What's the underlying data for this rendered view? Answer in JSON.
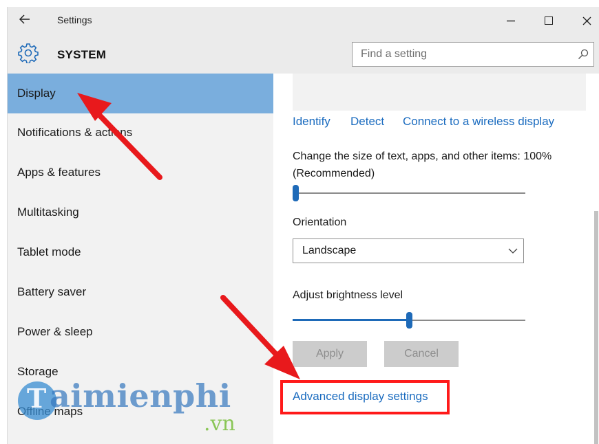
{
  "titlebar": {
    "back_icon": "back-arrow-icon",
    "title": "Settings",
    "minimize_icon": "minimize-icon",
    "maximize_icon": "maximize-icon",
    "close_icon": "close-icon"
  },
  "header": {
    "icon": "gear-icon",
    "title": "SYSTEM",
    "search": {
      "placeholder": "Find a setting",
      "icon": "search-icon"
    }
  },
  "sidebar": {
    "items": [
      {
        "label": "Display",
        "selected": true
      },
      {
        "label": "Notifications & actions",
        "selected": false
      },
      {
        "label": "Apps & features",
        "selected": false
      },
      {
        "label": "Multitasking",
        "selected": false
      },
      {
        "label": "Tablet mode",
        "selected": false
      },
      {
        "label": "Battery saver",
        "selected": false
      },
      {
        "label": "Power & sleep",
        "selected": false
      },
      {
        "label": "Storage",
        "selected": false
      },
      {
        "label": "Offline maps",
        "selected": false
      }
    ]
  },
  "content": {
    "links": {
      "identify": "Identify",
      "detect": "Detect",
      "connect": "Connect to a wireless display"
    },
    "size": {
      "label": "Change the size of text, apps, and other items: 100% (Recommended)",
      "slider_level": 0
    },
    "orientation": {
      "label": "Orientation",
      "value": "Landscape"
    },
    "brightness": {
      "label": "Adjust brightness level",
      "slider_level": 0.5
    },
    "buttons": {
      "apply": "Apply",
      "cancel": "Cancel"
    },
    "advanced_link": "Advanced display settings"
  },
  "colors": {
    "accent": "#1e6ab8",
    "link": "#1a6bbf",
    "sidebar_selected": "#7aaedd",
    "annotation_red": "#ff1a1a"
  },
  "watermark": {
    "brand": "aimienphi",
    "initial": "T",
    "suffix": ".vn"
  }
}
